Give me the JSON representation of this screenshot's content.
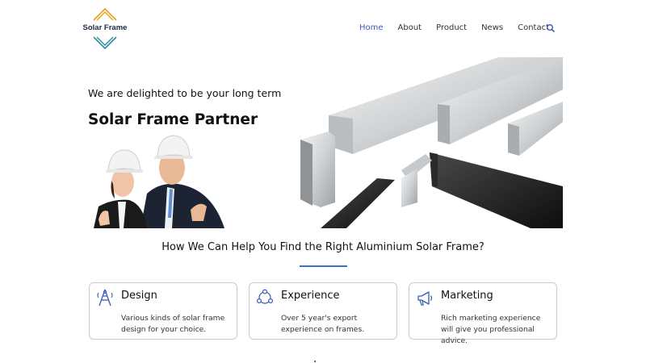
{
  "brand": {
    "name": "Solar Frame",
    "accent": "#3b5bb5",
    "logo_gold": "#e3a21a",
    "logo_teal": "#2c8b9c"
  },
  "nav": {
    "items": [
      {
        "label": "Home",
        "active": true
      },
      {
        "label": "About",
        "active": false
      },
      {
        "label": "Product",
        "active": false
      },
      {
        "label": "News",
        "active": false
      },
      {
        "label": "Contact",
        "active": false
      }
    ],
    "search_icon": "search-icon"
  },
  "hero": {
    "subtitle": "We are delighted to be your long term",
    "title": "Solar Frame Partner"
  },
  "help": {
    "heading": "How We Can Help You Find the Right Aluminium Solar Frame?"
  },
  "features": [
    {
      "title": "Design",
      "description": "Various kinds of solar frame design for your choice.",
      "icon": "tower-icon"
    },
    {
      "title": "Experience",
      "description": "Over 5 year's export experience on frames.",
      "icon": "network-icon"
    },
    {
      "title": "Marketing",
      "description": "Rich marketing experience will give you professional advice.",
      "icon": "megaphone-icon"
    }
  ]
}
